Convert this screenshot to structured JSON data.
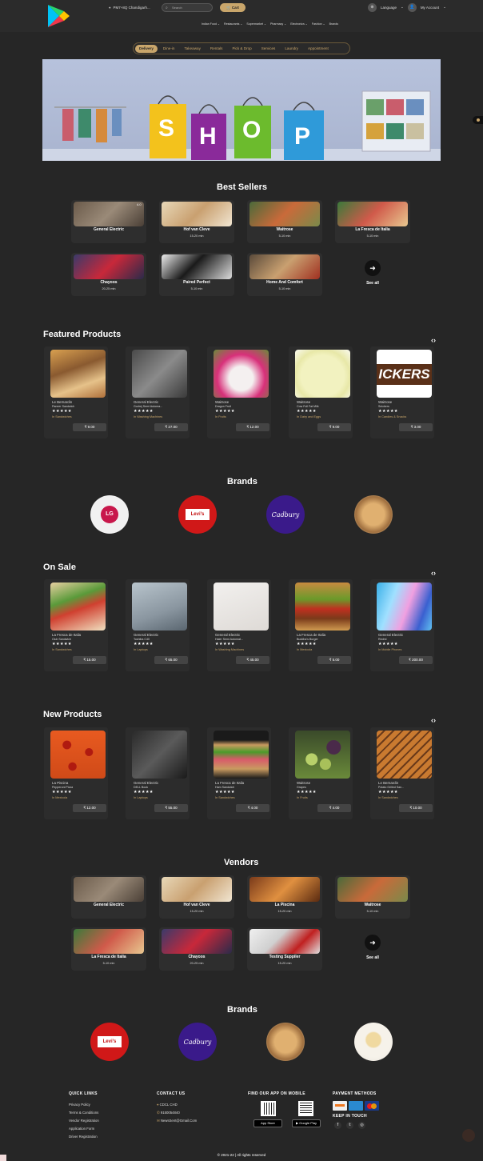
{
  "header": {
    "location": "PM7+8Q Chandigarh...",
    "search_placeholder": "Search",
    "cart_label": "Cart",
    "language_label": "Language",
    "account_label": "My Account",
    "categories": [
      "Indian Food",
      "Restaurants",
      "Supermarket",
      "Pharmacy",
      "Electronics",
      "Fashion",
      "Brands"
    ]
  },
  "service_tabs": [
    "Delivery",
    "Dine-in",
    "Takeaway",
    "Rentals",
    "Pick & Drop",
    "Services",
    "Laundry",
    "Appointment"
  ],
  "banner": {
    "letters": [
      "S",
      "H",
      "O",
      "P"
    ]
  },
  "best_sellers": {
    "title": "Best Sellers",
    "badge": "4.0",
    "stores": [
      {
        "name": "General Electric",
        "time": ""
      },
      {
        "name": "Hof van Cleve",
        "time": "15-20 min"
      },
      {
        "name": "Waitrose",
        "time": "5-10 min"
      },
      {
        "name": "La Fresca de Italia",
        "time": "5-10 min"
      },
      {
        "name": "Chayoos",
        "time": "20-25 min"
      },
      {
        "name": "Paired Perfect",
        "time": "5-10 min"
      },
      {
        "name": "Home And Comfort",
        "time": "5-10 min"
      }
    ],
    "see_all": "See all"
  },
  "featured": {
    "title": "Featured Products",
    "items": [
      {
        "vendor": "Le Bernardin",
        "name": "Paneer Sandwich",
        "category": "In Sandwiches",
        "price": "₹ 9.00"
      },
      {
        "vendor": "General Electric",
        "name": "Godrej Semi Automa...",
        "category": "In Washing Machines",
        "price": "₹ 27.00"
      },
      {
        "vendor": "Waitrose",
        "name": "Dragon Fruit",
        "category": "In Fruits",
        "price": "₹ 12.00"
      },
      {
        "vendor": "Waitrose",
        "name": "Cow Full Fat Milk",
        "category": "In Dairy and Eggs",
        "price": "₹ 9.00"
      },
      {
        "vendor": "Waitrose",
        "name": "Snickers",
        "category": "In Candies & Snacks",
        "price": "₹ 3.00"
      }
    ]
  },
  "brands1": {
    "title": "Brands",
    "items": [
      "LG",
      "Levi's",
      "Cadbury",
      ""
    ]
  },
  "on_sale": {
    "title": "On Sale",
    "items": [
      {
        "vendor": "La Fresca de Italia",
        "name": "Club Sandwich",
        "category": "In Sandwiches",
        "price": "₹ 15.00"
      },
      {
        "vendor": "General Electric",
        "name": "Toshiba C40",
        "category": "In Laptops",
        "price": "₹ 65.00"
      },
      {
        "vendor": "General Electric",
        "name": "Haier Semi Automat...",
        "category": "In Washing Machines",
        "price": "₹ 45.00"
      },
      {
        "vendor": "La Fresca de Italia",
        "name": "Buddha's Burger",
        "category": "In Mexicola",
        "price": "₹ 5.00"
      },
      {
        "vendor": "General Electric",
        "name": "Redmi",
        "category": "In Mobile Phones",
        "price": "₹ 200.00"
      }
    ]
  },
  "new_products": {
    "title": "New Products",
    "items": [
      {
        "vendor": "La Piscina",
        "name": "Pepperoni Pizza",
        "category": "In Mexicola",
        "price": "₹ 12.00"
      },
      {
        "vendor": "General Electric",
        "name": "DELL Book",
        "category": "In Laptops",
        "price": "₹ 55.00"
      },
      {
        "vendor": "La Fresca de Italia",
        "name": "Ham Sandwich",
        "category": "In Sandwiches",
        "price": "₹ 4.00"
      },
      {
        "vendor": "Waitrose",
        "name": "Grapes",
        "category": "In Fruits",
        "price": "₹ 4.00"
      },
      {
        "vendor": "Le Bernardin",
        "name": "Potato Grilled San...",
        "category": "In Sandwiches",
        "price": "₹ 10.00"
      }
    ]
  },
  "vendors": {
    "title": "Vendors",
    "stores": [
      {
        "name": "General Electric",
        "time": ""
      },
      {
        "name": "Hof van Cleve",
        "time": "15-20 min"
      },
      {
        "name": "La Piscina",
        "time": "15-20 min"
      },
      {
        "name": "Waitrose",
        "time": "5-10 min"
      },
      {
        "name": "La Fresca de Italia",
        "time": "5-10 min"
      },
      {
        "name": "Chayoos",
        "time": "20-25 min"
      },
      {
        "name": "Testing Suppiler",
        "time": "15-20 min"
      }
    ],
    "see_all": "See all"
  },
  "brands2": {
    "title": "Brands",
    "items": [
      "Levi's",
      "Cadbury",
      "",
      ""
    ]
  },
  "footer": {
    "quick_links_title": "QUICK LINKS",
    "quick_links": [
      "Privacy Policy",
      "Terms & Conditions",
      "Vendor Registration",
      "Application Form",
      "Driver Registration"
    ],
    "contact_title": "CONTACT US",
    "contact": [
      "CDCL CHD",
      "9150054840",
      "NewsSent@Gmail.Com"
    ],
    "app_title": "FIND OUR APP ON MOBILE",
    "app_store": "App Store",
    "google_play": "Google Play",
    "payment_title": "PAYMENT METHODS",
    "keep_title": "KEEP IN TOUCH",
    "copyright": "© 2021-22 | All rights reserved"
  },
  "stars": "★★★★★",
  "colors": {
    "accent": "#c9a66b",
    "background": "#262626",
    "card": "#2c2c2c"
  }
}
